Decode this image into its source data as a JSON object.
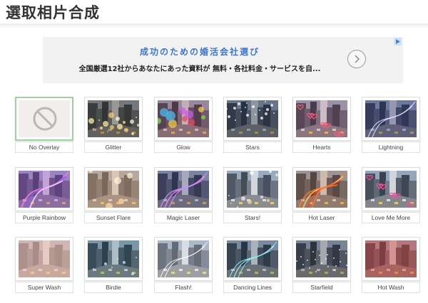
{
  "header": {
    "title": "選取相片合成"
  },
  "ad": {
    "headline": "成功のための婚活会社選び",
    "body_main": "全国厳選12社からあなたにあった資料が 無料・各社料金・サービスを自...",
    "badge_icon": "ad-choices-icon",
    "arrow_icon": "chevron-right-icon"
  },
  "overlays": [
    {
      "label": "No Overlay",
      "selected": true
    },
    {
      "label": "Glitter"
    },
    {
      "label": "Glow"
    },
    {
      "label": "Stars"
    },
    {
      "label": "Hearts"
    },
    {
      "label": "Lightning"
    },
    {
      "label": "Purple Rainbow"
    },
    {
      "label": "Sunset Flare"
    },
    {
      "label": "Magic Laser"
    },
    {
      "label": "Stars!"
    },
    {
      "label": "Hot Laser"
    },
    {
      "label": "Love Me More"
    },
    {
      "label": "Super Wash"
    },
    {
      "label": "Birdie"
    },
    {
      "label": "Flash!"
    },
    {
      "label": "Dancing Lines"
    },
    {
      "label": "Starfield"
    },
    {
      "label": "Hot Wash"
    }
  ],
  "colors": {
    "selected_border": "#9bd39a",
    "ad_headline": "#3b75d8"
  }
}
